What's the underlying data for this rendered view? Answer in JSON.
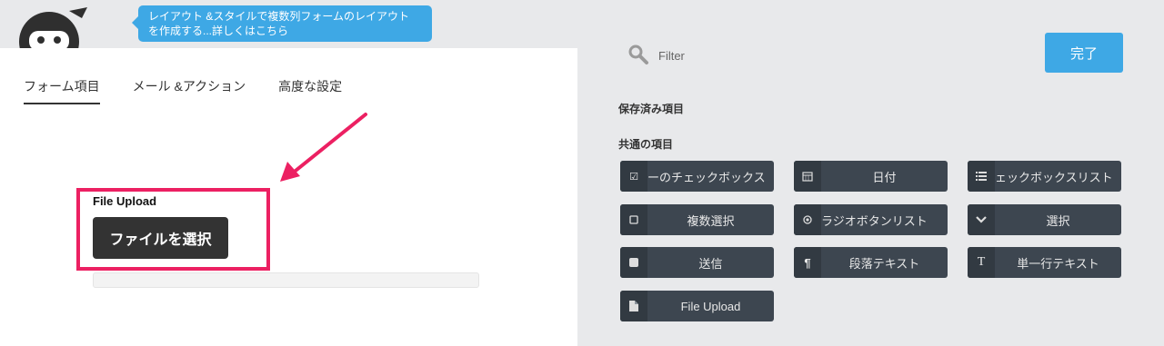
{
  "tooltip": {
    "line1": "レイアウト &スタイルで複数列フォームのレイアウト",
    "line2": "を作成する...詳しくはこちら"
  },
  "tabs": [
    {
      "label": "フォーム項目",
      "active": true
    },
    {
      "label": "メール &アクション",
      "active": false
    },
    {
      "label": "高度な設定",
      "active": false
    }
  ],
  "form": {
    "field_label": "File Upload",
    "file_button_label": "ファイルを選択"
  },
  "search": {
    "placeholder": "Filter"
  },
  "done_label": "完了",
  "sections": {
    "saved": "保存済み項目",
    "common": "共通の項目"
  },
  "fields": [
    {
      "label": "ーのチェックボックス",
      "icon": "checkbox-icon"
    },
    {
      "label": "日付",
      "icon": "calendar-icon"
    },
    {
      "label": "ェックボックスリスト",
      "icon": "list-icon"
    },
    {
      "label": "複数選択",
      "icon": "square-icon"
    },
    {
      "label": "ラジオボタンリスト",
      "icon": "radio-icon"
    },
    {
      "label": "選択",
      "icon": "chevron-down-icon"
    },
    {
      "label": "送信",
      "icon": "filled-square-icon"
    },
    {
      "label": "段落テキスト",
      "icon": "pilcrow-icon"
    },
    {
      "label": "単一行テキスト",
      "icon": "text-icon"
    },
    {
      "label": "File Upload",
      "icon": "file-icon"
    }
  ],
  "colors": {
    "accent": "#3ea8e5",
    "highlight": "#ec2062",
    "field_bg": "#3d4650"
  }
}
